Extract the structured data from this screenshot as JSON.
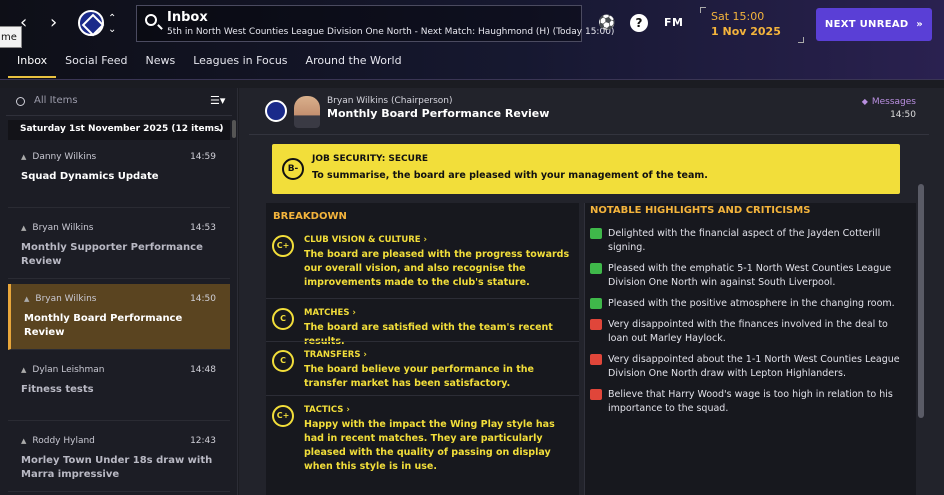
{
  "topbar": {
    "home_chip": "me",
    "inbox_title": "Inbox",
    "inbox_subtitle": "5th in North West Counties League Division One North - Next Match: Haughmond (H) (Today 15:00)",
    "fm_label": "FM",
    "help_label": "?",
    "date_day": "Sat 15:00",
    "date_date": "1 Nov 2025",
    "next_unread": "NEXT UNREAD",
    "next_icon": "»"
  },
  "tabs": [
    {
      "label": "Inbox"
    },
    {
      "label": "Social Feed"
    },
    {
      "label": "News"
    },
    {
      "label": "Leagues in Focus"
    },
    {
      "label": "Around the World"
    }
  ],
  "left": {
    "search_placeholder": "All Items",
    "day_header": "Saturday 1st November 2025 (12 items)",
    "messages": [
      {
        "person": "Danny Wilkins",
        "time": "14:59",
        "title": "Squad Dynamics Update"
      },
      {
        "person": "Bryan Wilkins",
        "time": "14:53",
        "title": "Monthly Supporter Performance Review"
      },
      {
        "person": "Bryan Wilkins",
        "time": "14:50",
        "title": "Monthly Board Performance Review"
      },
      {
        "person": "Dylan Leishman",
        "time": "14:48",
        "title": "Fitness tests"
      },
      {
        "person": "Roddy Hyland",
        "time": "12:43",
        "title": "Morley Town Under 18s draw with Marra impressive"
      }
    ]
  },
  "message": {
    "from": "Bryan Wilkins  (Chairperson)",
    "subject": "Monthly Board Performance Review",
    "messages_link": "Messages",
    "time": "14:50",
    "security": {
      "grade": "B-",
      "title": "JOB SECURITY: SECURE",
      "text": "To summarise, the board are pleased with your management of the team."
    },
    "breakdown_title": "BREAKDOWN",
    "breakdown": [
      {
        "grade": "C+",
        "title": "CLUB VISION & CULTURE",
        "text": "The board are pleased with the progress towards our overall vision, and also recognise the improvements made to the club's stature."
      },
      {
        "grade": "C",
        "title": "MATCHES",
        "text": "The board are satisfied with the team's recent results."
      },
      {
        "grade": "C",
        "title": "TRANSFERS",
        "text": "The board believe your performance in the transfer market has been satisfactory."
      },
      {
        "grade": "C+",
        "title": "TACTICS",
        "text": "Happy with the impact the Wing Play style has had in recent matches. They are particularly pleased with the quality of passing on display when this style is in use."
      }
    ],
    "notable_title": "NOTABLE HIGHLIGHTS AND CRITICISMS",
    "notable": [
      {
        "sentiment": "up",
        "text": "Delighted with the financial aspect of the Jayden Cotterill signing."
      },
      {
        "sentiment": "up",
        "text": "Pleased with the emphatic 5-1 North West Counties League Division One North win against South Liverpool."
      },
      {
        "sentiment": "up",
        "text": "Pleased with the positive atmosphere in the changing room."
      },
      {
        "sentiment": "down",
        "text": "Very disappointed with the finances involved in the deal to loan out Marley Haylock."
      },
      {
        "sentiment": "down",
        "text": "Very disappointed about the 1-1 North West Counties League Division One North draw with Lepton Highlanders."
      },
      {
        "sentiment": "down",
        "text": "Believe that Harry Wood's wage is too high in relation to his importance to the squad."
      }
    ]
  },
  "colors": {
    "accent_button": "#5a3fd6",
    "date_text": "#f4b43c",
    "security_banner": "#f2de3a",
    "selected_message": "#5a4420"
  }
}
